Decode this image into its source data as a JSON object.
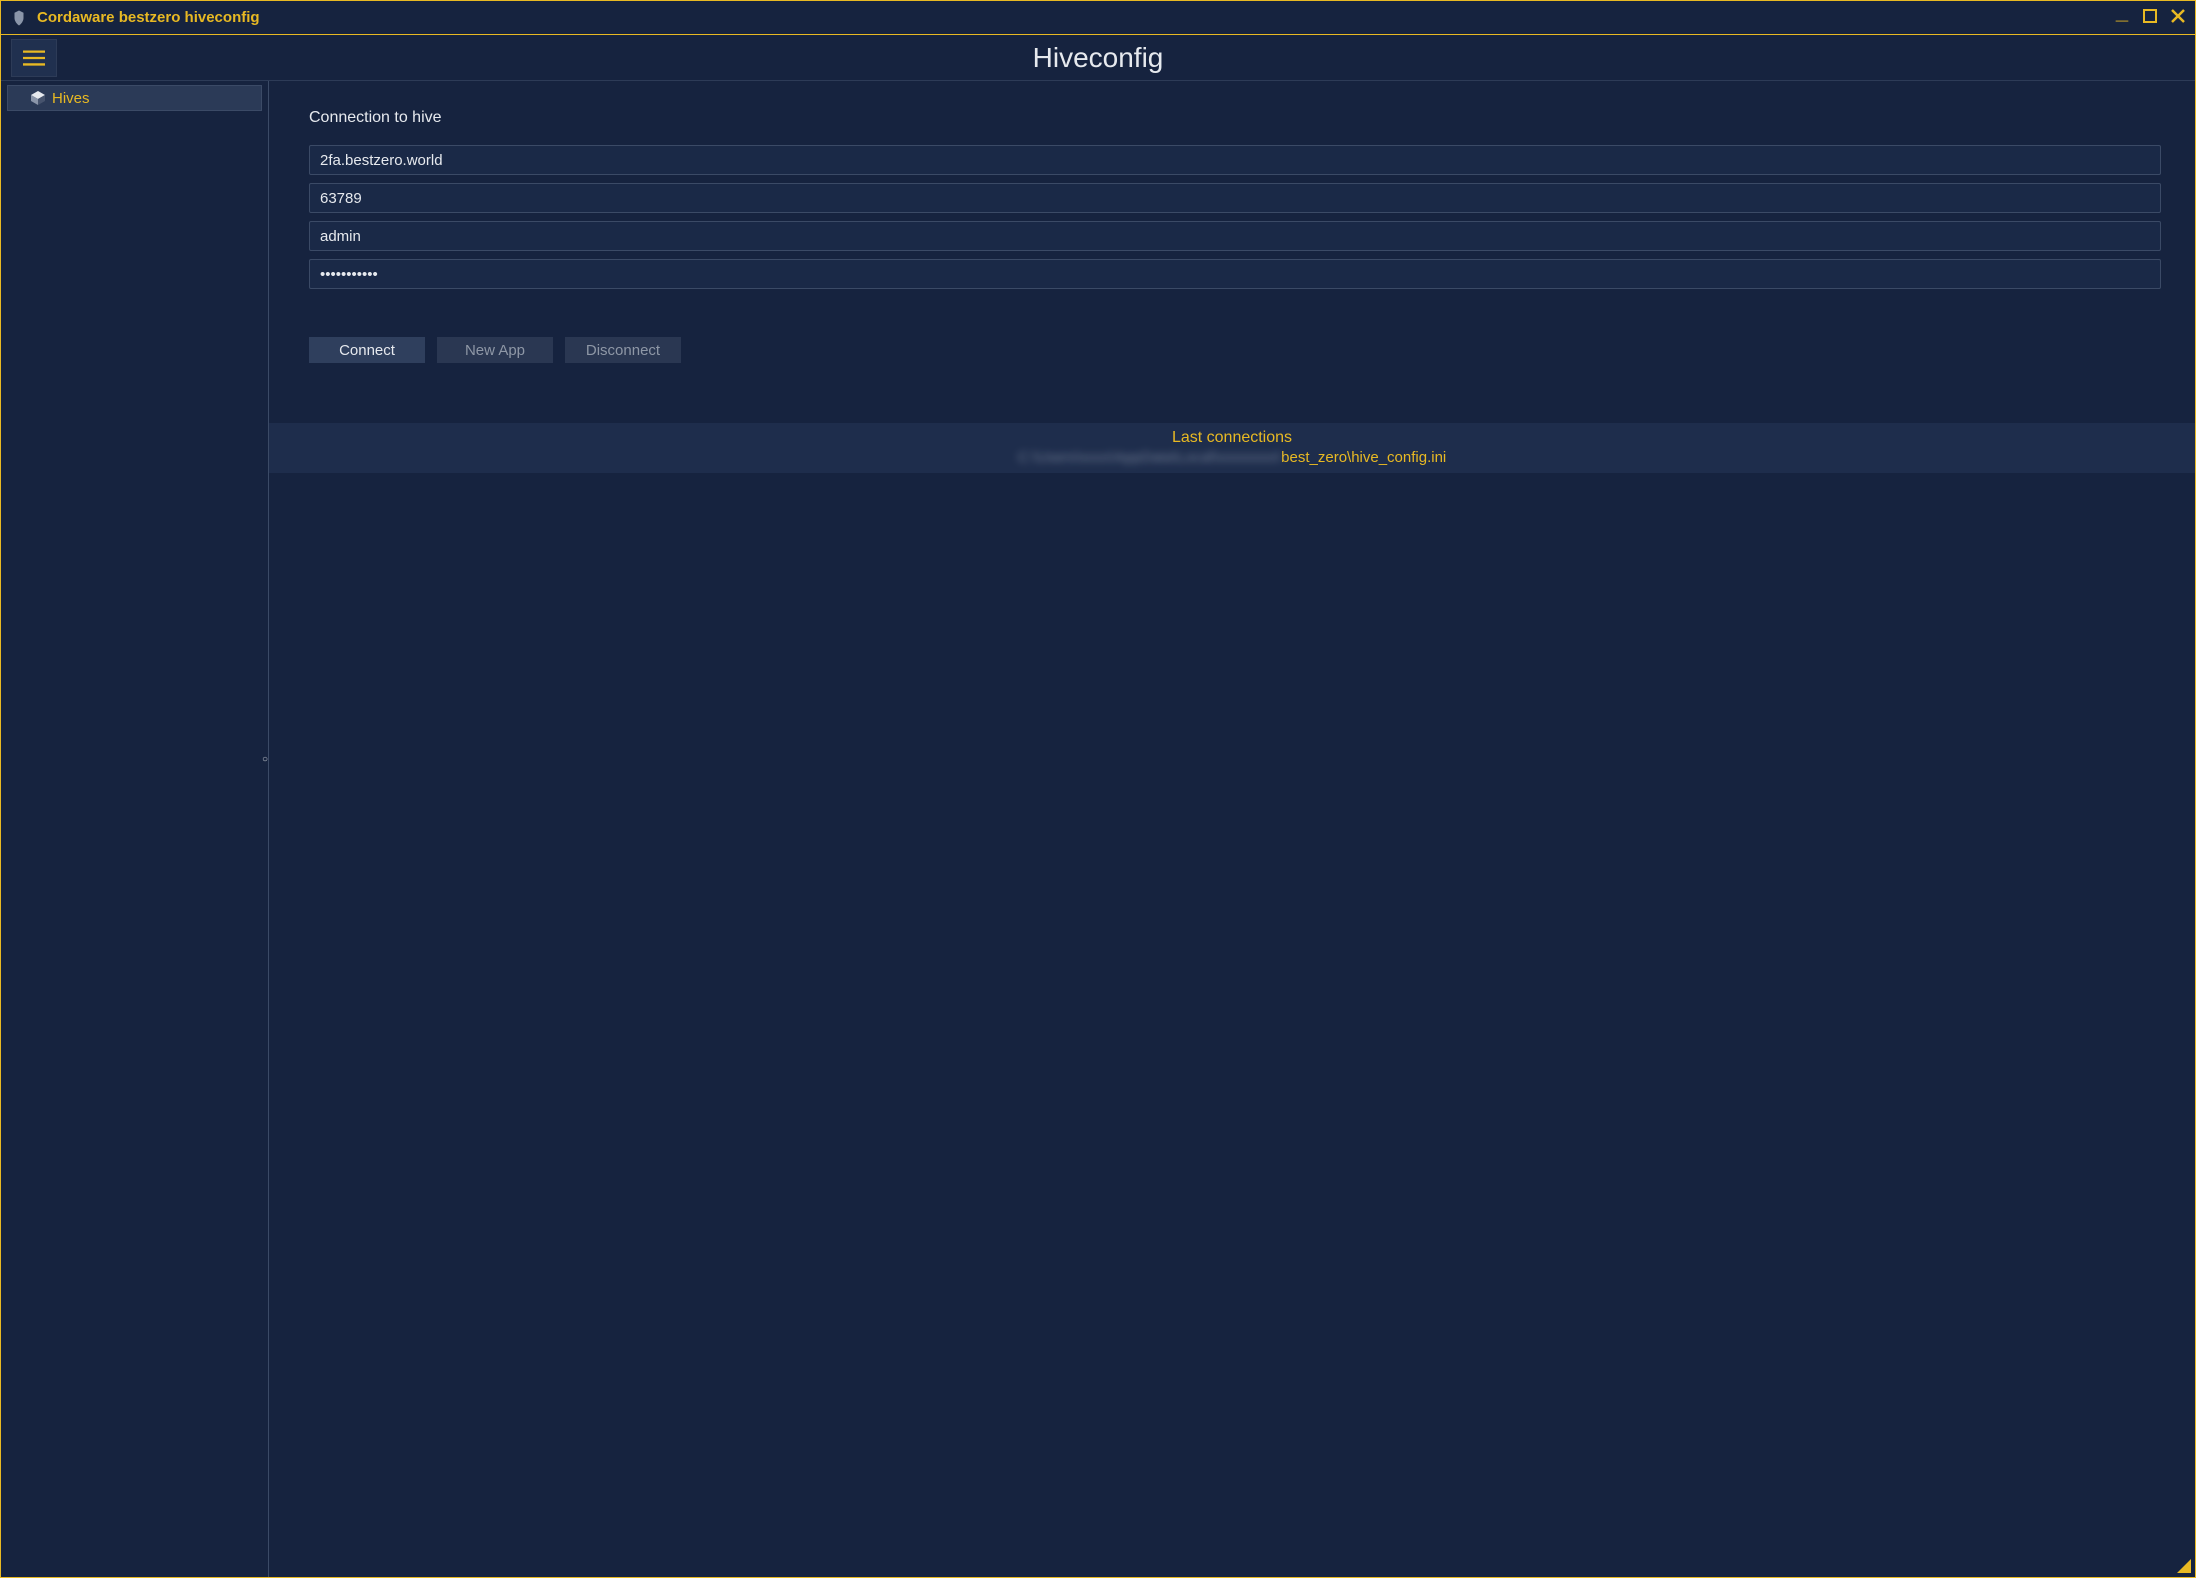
{
  "window": {
    "title": "Cordaware bestzero hiveconfig"
  },
  "app": {
    "title": "Hiveconfig"
  },
  "sidebar": {
    "items": [
      {
        "label": "Hives"
      }
    ]
  },
  "form": {
    "heading": "Connection to hive",
    "host": "2fa.bestzero.world",
    "port": "63789",
    "username": "admin",
    "password": "•••••••••••"
  },
  "buttons": {
    "connect": "Connect",
    "new_app": "New App",
    "disconnect": "Disconnect"
  },
  "last_connections": {
    "title": "Last connections",
    "path_obscured": "C:\\Users\\xxxx\\AppData\\Local\\xxxxxxxx\\",
    "path_visible": "best_zero\\hive_config.ini"
  }
}
